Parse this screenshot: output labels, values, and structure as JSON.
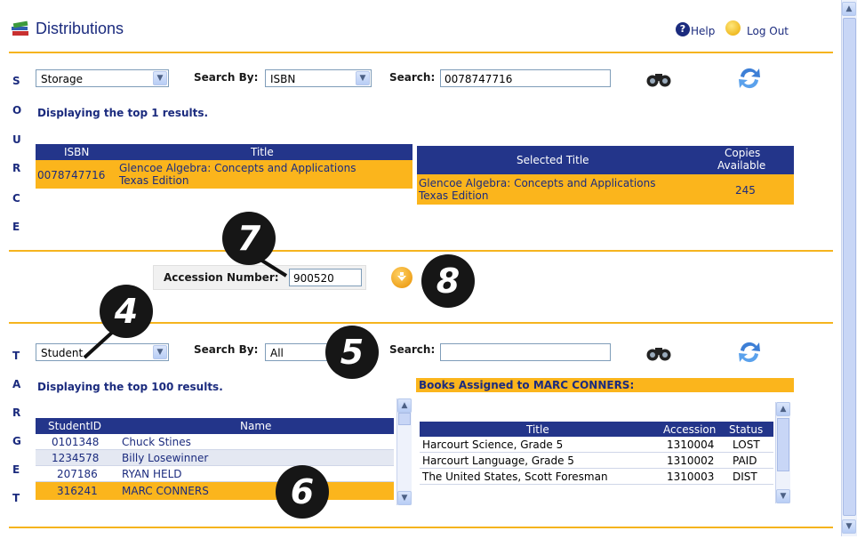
{
  "header": {
    "title": "Distributions",
    "help": "Help",
    "logout": "Log Out"
  },
  "source": {
    "letters": [
      "S",
      "O",
      "U",
      "R",
      "C",
      "E"
    ],
    "location_select": "Storage",
    "search_by_label": "Search By:",
    "search_by_value": "ISBN",
    "search_label": "Search:",
    "search_value": "0078747716",
    "results_text": "Displaying the top 1 results.",
    "table": {
      "headers": [
        "ISBN",
        "Title"
      ],
      "rows": [
        {
          "isbn": "0078747716",
          "title_line1": "Glencoe Algebra: Concepts and Applications",
          "title_line2": "Texas Edition"
        }
      ]
    },
    "selected": {
      "headers": [
        "Selected Title",
        "Copies",
        "Available"
      ],
      "title_line1": "Glencoe Algebra: Concepts and Applications",
      "title_line2": "Texas Edition",
      "copies": "245"
    }
  },
  "accession": {
    "label": "Accession Number:",
    "value": "900520"
  },
  "target": {
    "letters": [
      "T",
      "A",
      "R",
      "G",
      "E",
      "T"
    ],
    "type_select": "Student",
    "search_by_label": "Search By:",
    "search_by_value": "All",
    "search_label": "Search:",
    "search_value": "",
    "results_text": "Displaying the top 100 results.",
    "books_header": "Books Assigned to MARC CONNERS:",
    "students": {
      "headers": [
        "StudentID",
        "Name"
      ],
      "rows": [
        {
          "id": "0101348",
          "name": "Chuck Stines"
        },
        {
          "id": "1234578",
          "name": "Billy Losewinner"
        },
        {
          "id": "207186",
          "name": "RYAN HELD"
        },
        {
          "id": "316241",
          "name": "MARC CONNERS"
        }
      ]
    },
    "books": {
      "headers": [
        "Title",
        "Accession",
        "Status"
      ],
      "rows": [
        {
          "title": "Harcourt Science, Grade 5",
          "accession": "1310004",
          "status": "LOST"
        },
        {
          "title": "Harcourt Language, Grade 5",
          "accession": "1310002",
          "status": "PAID"
        },
        {
          "title": "The United States, Scott Foresman",
          "accession": "1310003",
          "status": "DIST"
        }
      ]
    }
  },
  "callouts": [
    "4",
    "5",
    "6",
    "7",
    "8"
  ],
  "colors": {
    "accent": "#fbb51c",
    "navy": "#23358a",
    "rule": "#f5b41e"
  },
  "icons": [
    "books-icon",
    "help-icon",
    "logout-icon",
    "binoculars-icon",
    "refresh-icon",
    "down-arrow-icon"
  ]
}
